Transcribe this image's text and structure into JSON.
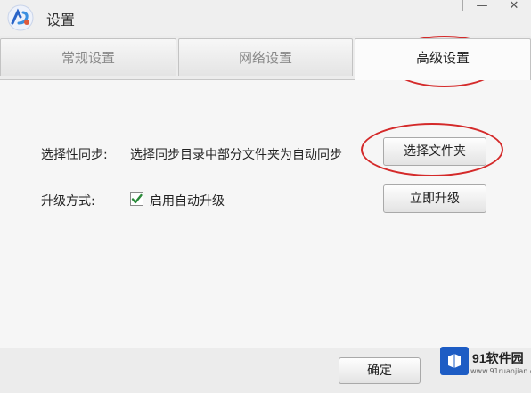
{
  "window": {
    "title": "设置",
    "minimize_glyph": "—",
    "close_glyph": "✕"
  },
  "tabs": [
    {
      "label": "常规设置",
      "active": false
    },
    {
      "label": "网络设置",
      "active": false
    },
    {
      "label": "高级设置",
      "active": true
    }
  ],
  "advanced": {
    "selective_sync": {
      "label": "选择性同步:",
      "description": "选择同步目录中部分文件夹为自动同步",
      "button": "选择文件夹"
    },
    "upgrade": {
      "label": "升级方式:",
      "auto_upgrade_checked": true,
      "auto_upgrade_label": "启用自动升级",
      "button": "立即升级"
    }
  },
  "footer": {
    "ok_button": "确定"
  },
  "watermark": {
    "brand": "91软件园",
    "url": "www.91ruanjian.com"
  },
  "colors": {
    "highlight_ring": "#d42a2a",
    "checkmark": "#2a8a3a",
    "logo_blue": "#2a64c8",
    "watermark_blue": "#1d5cc4"
  }
}
